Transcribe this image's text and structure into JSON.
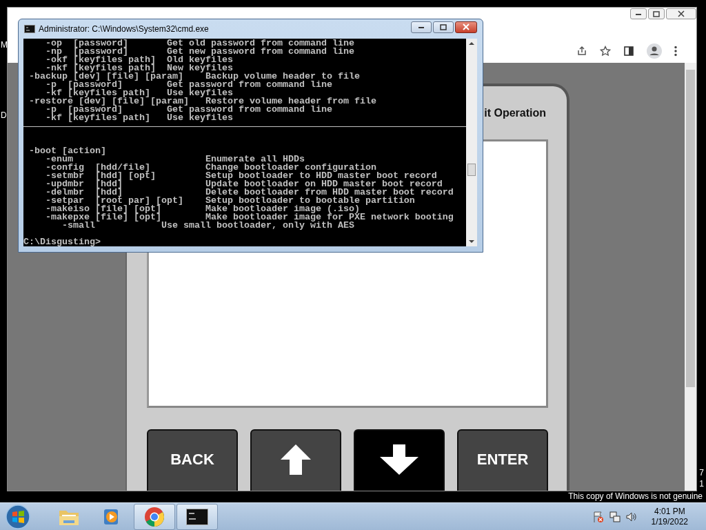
{
  "desktop": {
    "left_edge_labels": [
      "M",
      "D"
    ],
    "right_edge_labels": [
      "7",
      "1"
    ],
    "notice": "This copy of Windows is not genuine"
  },
  "browser": {
    "page": {
      "panel_title": "it Operation",
      "buttons": [
        {
          "kind": "text",
          "label": "BACK",
          "selected": false
        },
        {
          "kind": "up",
          "selected": false
        },
        {
          "kind": "down",
          "selected": true
        },
        {
          "kind": "text",
          "label": "ENTER",
          "selected": false
        }
      ]
    }
  },
  "console_window": {
    "title": "Administrator: C:\\Windows\\System32\\cmd.exe",
    "lines": [
      {
        "kind": "text",
        "text": "    -op  [password]       Get old password from command line"
      },
      {
        "kind": "text",
        "text": "    -np  [password]       Get new password from command line"
      },
      {
        "kind": "text",
        "text": "    -okf [keyfiles path]  Old keyfiles"
      },
      {
        "kind": "text",
        "text": "    -nkf [keyfiles path]  New keyfiles"
      },
      {
        "kind": "text",
        "text": " -backup [dev] [file] [param]    Backup volume header to file"
      },
      {
        "kind": "text",
        "text": "    -p  [password]        Get password from command line"
      },
      {
        "kind": "text",
        "text": "    -kf [keyfiles path]   Use keyfiles"
      },
      {
        "kind": "text",
        "text": " -restore [dev] [file] [param]   Restore volume header from file"
      },
      {
        "kind": "text",
        "text": "    -p  [password]        Get password from command line"
      },
      {
        "kind": "text",
        "text": "    -kf [keyfiles path]   Use keyfiles"
      },
      {
        "kind": "rule"
      },
      {
        "kind": "blank"
      },
      {
        "kind": "blank"
      },
      {
        "kind": "text",
        "text": " -boot [action]"
      },
      {
        "kind": "text",
        "text": "    -enum                        Enumerate all HDDs"
      },
      {
        "kind": "text",
        "text": "    -config  [hdd/file]          Change bootloader configuration"
      },
      {
        "kind": "text",
        "text": "    -setmbr  [hdd] [opt]         Setup bootloader to HDD master boot record"
      },
      {
        "kind": "text",
        "text": "    -updmbr  [hdd]               Update bootloader on HDD master boot record"
      },
      {
        "kind": "text",
        "text": "    -delmbr  [hdd]               Delete bootloader from HDD master boot record"
      },
      {
        "kind": "text",
        "text": "    -setpar  [root par] [opt]    Setup bootloader to bootable partition"
      },
      {
        "kind": "text",
        "text": "    -makeiso [file] [opt]        Make bootloader image (.iso)"
      },
      {
        "kind": "text",
        "text": "    -makepxe [file] [opt]        Make bootloader image for PXE network booting"
      },
      {
        "kind": "text",
        "text": "       -small            Use small bootloader, only with AES"
      },
      {
        "kind": "blank"
      },
      {
        "kind": "text",
        "text": "C:\\Disgusting>"
      }
    ]
  },
  "taskbar": {
    "apps": [
      {
        "kind": "explorer",
        "open": false
      },
      {
        "kind": "media",
        "open": false
      },
      {
        "kind": "browser",
        "open": true
      },
      {
        "kind": "console",
        "open": true
      }
    ],
    "time": "4:01 PM",
    "date": "1/19/2022"
  }
}
